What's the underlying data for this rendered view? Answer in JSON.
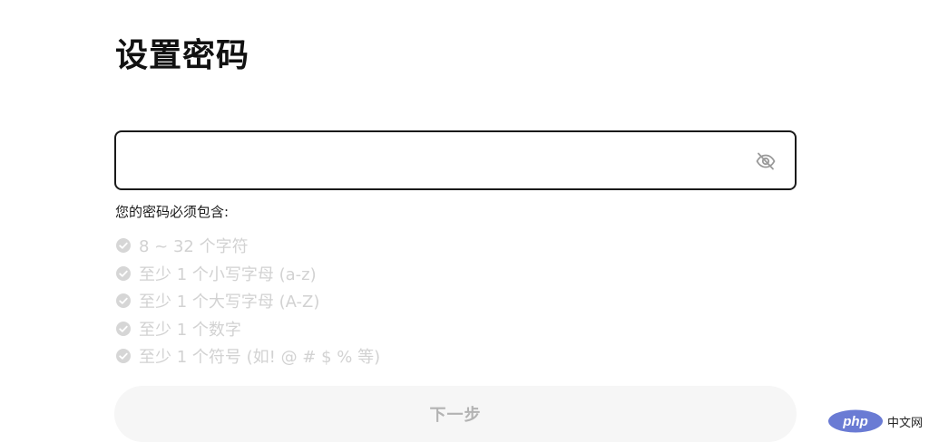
{
  "page": {
    "title": "设置密码"
  },
  "password_field": {
    "value": "",
    "placeholder": "",
    "toggle_icon": "eye-off-icon"
  },
  "requirements": {
    "heading": "您的密码必须包含:",
    "items": [
      {
        "label": "8 ~ 32 个字符",
        "met": false
      },
      {
        "label": "至少 1 个小写字母 (a-z)",
        "met": false
      },
      {
        "label": "至少 1 个大写字母 (A-Z)",
        "met": false
      },
      {
        "label": "至少 1 个数字",
        "met": false
      },
      {
        "label": "至少 1 个符号 (如! @ # $ % 等)",
        "met": false
      }
    ],
    "inactive_color": "#d2d2d2"
  },
  "next_button": {
    "label": "下一步",
    "disabled": true,
    "background": "#f6f6f6",
    "text_color": "#b3b3b3"
  },
  "watermark": {
    "logo_text": "php",
    "text": "中文网",
    "logo_color": "#6a7bd4"
  }
}
